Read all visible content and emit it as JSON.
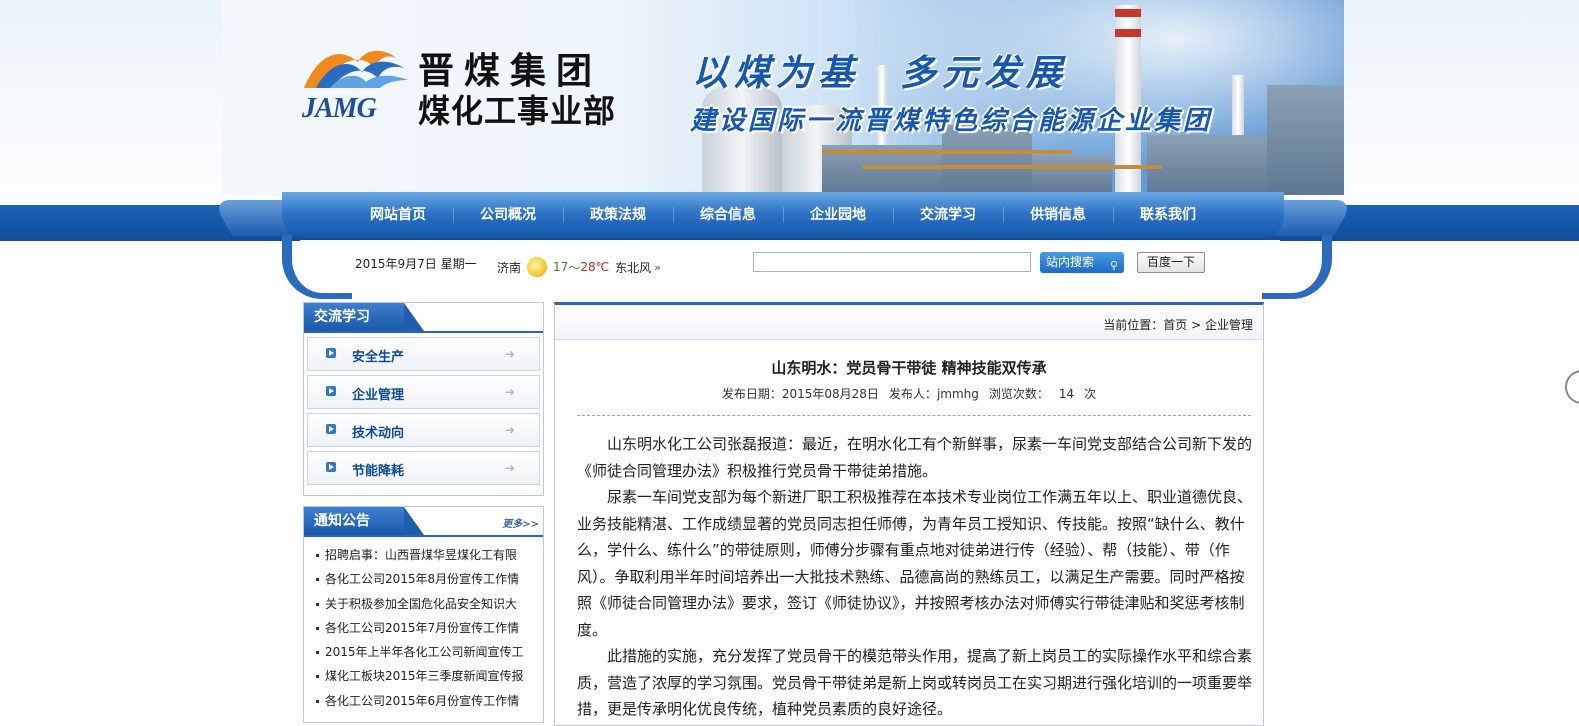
{
  "logo": {
    "abbr": "JAMG",
    "title_line1": "晋煤集团",
    "title_line2": "煤化工事业部"
  },
  "slogan": {
    "line1_a": "以煤为基",
    "line1_b": "多元发展",
    "line2": "建设国际一流晋煤特色综合能源企业集团"
  },
  "nav": [
    {
      "label": "网站首页"
    },
    {
      "label": "公司概况"
    },
    {
      "label": "政策法规"
    },
    {
      "label": "综合信息"
    },
    {
      "label": "企业园地"
    },
    {
      "label": "交流学习"
    },
    {
      "label": "供销信息"
    },
    {
      "label": "联系我们"
    }
  ],
  "infobar": {
    "date": "2015年9月7日 星期一",
    "city": "济南",
    "temp_low": "17",
    "temp_sep": "～",
    "temp_high": "28℃",
    "wind": "东北风",
    "search_value": "",
    "site_search_label": "站内搜索",
    "baidu_label": "百度一下"
  },
  "sidebar": {
    "study_title": "交流学习",
    "study_items": [
      {
        "label": "安全生产"
      },
      {
        "label": "企业管理"
      },
      {
        "label": "技术动向"
      },
      {
        "label": "节能降耗"
      }
    ],
    "notice_title": "通知公告",
    "notice_more": "更多>>",
    "notices": [
      "招聘启事：山西晋煤华昱煤化工有限",
      "各化工公司2015年8月份宣传工作情",
      "关于积极参加全国危化品安全知识大",
      "各化工公司2015年7月份宣传工作情",
      "2015年上半年各化工公司新闻宣传工",
      "煤化工板块2015年三季度新闻宣传报",
      "各化工公司2015年6月份宣传工作情"
    ]
  },
  "breadcrumb": {
    "prefix": "当前位置：",
    "home": "首页",
    "sep": " > ",
    "current": "企业管理"
  },
  "article": {
    "title": "山东明水：党员骨干带徒 精神技能双传承",
    "date_label": "发布日期：",
    "date": "2015年08月28日",
    "publisher_label": "发布人：",
    "publisher": "jmmhg",
    "views_label": "浏览次数：",
    "views": "14",
    "views_unit": "次",
    "paragraphs": [
      "山东明水化工公司张磊报道：最近，在明水化工有个新鲜事，尿素一车间党支部结合公司新下发的《师徒合同管理办法》积极推行党员骨干带徒弟措施。",
      "尿素一车间党支部为每个新进厂职工积极推荐在本技术专业岗位工作满五年以上、职业道德优良、业务技能精湛、工作成绩显著的党员同志担任师傅，为青年员工授知识、传技能。按照“缺什么、教什么，学什么、练什么”的带徒原则，师傅分步骤有重点地对徒弟进行传（经验）、帮（技能）、带（作风）。争取利用半年时间培养出一大批技术熟练、品德高尚的熟练员工，以满足生产需要。同时严格按照《师徒合同管理办法》要求，签订《师徒协议》，并按照考核办法对师傅实行带徒津贴和奖惩考核制度。",
      "此措施的实施，充分发挥了党员骨干的模范带头作用，提高了新上岗员工的实际操作水平和综合素质，营造了浓厚的学习氛围。党员骨干带徒弟是新上岗或转岗员工在实习期进行强化培训的一项重要举措，更是传承明化优良传统，植种党员素质的良好途径。"
    ]
  },
  "colors": {
    "nav_blue": "#1b58a8",
    "link_blue": "#114a98",
    "temp_low": "#2e8b2e",
    "temp_high": "#cc2222"
  }
}
